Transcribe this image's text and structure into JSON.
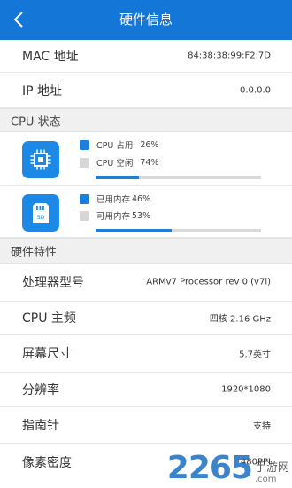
{
  "header": {
    "title": "硬件信息",
    "back_icon": "chevron-left-icon"
  },
  "network": {
    "mac_label": "MAC 地址",
    "mac_value": "84:38:38:99:F2:7D",
    "ip_label": "IP 地址",
    "ip_value": "0.0.0.0"
  },
  "cpu_status": {
    "section_title": "CPU 状态",
    "cpu": {
      "icon": "cpu-chip-icon",
      "used_label": "CPU 占用",
      "used_pct": "26%",
      "idle_label": "CPU 空闲",
      "idle_pct": "74%",
      "used_fraction": 0.26
    },
    "memory": {
      "icon": "memory-card-icon",
      "used_label": "已用内存",
      "used_pct": "46%",
      "free_label": "可用内存",
      "free_pct": "53%",
      "used_fraction": 0.46
    }
  },
  "hardware": {
    "section_title": "硬件特性",
    "rows": [
      {
        "label": "处理器型号",
        "value": "ARMv7 Processor rev 0 (v7l)"
      },
      {
        "label": "CPU 主频",
        "value": "四核 2.16 GHz"
      },
      {
        "label": "屏幕尺寸",
        "value": "5.7英寸"
      },
      {
        "label": "分辨率",
        "value": "1920*1080"
      },
      {
        "label": "指南针",
        "value": "支持"
      },
      {
        "label": "像素密度",
        "value": "480PPI"
      }
    ]
  },
  "watermark": {
    "number": "2265",
    "cn": "手游网",
    "domain": ".com"
  },
  "colors": {
    "accent": "#1476d6",
    "tile": "#1c89e6",
    "section_bg": "#f0f0f0"
  }
}
